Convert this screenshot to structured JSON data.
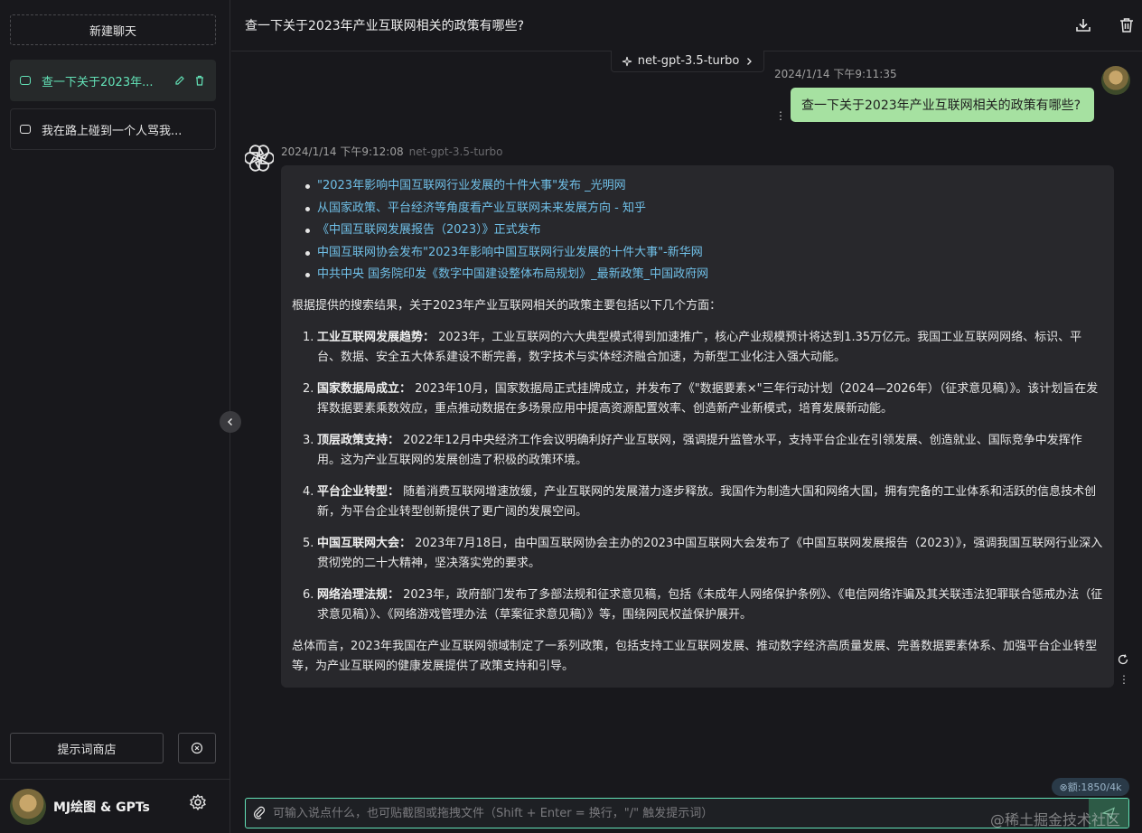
{
  "sidebar": {
    "new_chat": "新建聊天",
    "sessions": [
      {
        "title": "查一下关于2023年..."
      },
      {
        "title": "我在路上碰到一个人骂我..."
      }
    ],
    "prompt_store": "提示词商店",
    "user_name": "MJ绘图 & GPTs"
  },
  "header": {
    "title": "查一下关于2023年产业互联网相关的政策有哪些?"
  },
  "model_chip": "net-gpt-3.5-turbo",
  "user_message": {
    "time": "2024/1/14 下午9:11:35",
    "text": "查一下关于2023年产业互联网相关的政策有哪些?"
  },
  "bot_message": {
    "time": "2024/1/14 下午9:12:08",
    "model": "net-gpt-3.5-turbo",
    "links": [
      "\"2023年影响中国互联网行业发展的十件大事\"发布 _光明网",
      "从国家政策、平台经济等角度看产业互联网未来发展方向 - 知乎",
      "《中国互联网发展报告（2023）》正式发布",
      "中国互联网协会发布\"2023年影响中国互联网行业发展的十件大事\"-新华网",
      "中共中央 国务院印发《数字中国建设整体布局规划》_最新政策_中国政府网"
    ],
    "intro": "根据提供的搜索结果，关于2023年产业互联网相关的政策主要包括以下几个方面：",
    "points": [
      {
        "num": "1.",
        "title": "工业互联网发展趋势：",
        "text": " 2023年，工业互联网的六大典型模式得到加速推广，核心产业规模预计将达到1.35万亿元。我国工业互联网网络、标识、平台、数据、安全五大体系建设不断完善，数字技术与实体经济融合加速，为新型工业化注入强大动能。"
      },
      {
        "num": "2.",
        "title": "国家数据局成立：",
        "text": " 2023年10月，国家数据局正式挂牌成立，并发布了《\"数据要素×\"三年行动计划（2024—2026年）（征求意见稿）》。该计划旨在发挥数据要素乘数效应，重点推动数据在多场景应用中提高资源配置效率、创造新产业新模式，培育发展新动能。"
      },
      {
        "num": "3.",
        "title": "顶层政策支持：",
        "text": " 2022年12月中央经济工作会议明确利好产业互联网，强调提升监管水平，支持平台企业在引领发展、创造就业、国际竞争中发挥作用。这为产业互联网的发展创造了积极的政策环境。"
      },
      {
        "num": "4.",
        "title": "平台企业转型：",
        "text": " 随着消费互联网增速放缓，产业互联网的发展潜力逐步释放。我国作为制造大国和网络大国，拥有完备的工业体系和活跃的信息技术创新，为平台企业转型创新提供了更广阔的发展空间。"
      },
      {
        "num": "5.",
        "title": "中国互联网大会：",
        "text": " 2023年7月18日，由中国互联网协会主办的2023中国互联网大会发布了《中国互联网发展报告（2023）》，强调我国互联网行业深入贯彻党的二十大精神，坚决落实党的要求。"
      },
      {
        "num": "6.",
        "title": "网络治理法规：",
        "text": " 2023年，政府部门发布了多部法规和征求意见稿，包括《未成年人网络保护条例》、《电信网络诈骗及其关联违法犯罪联合惩戒办法（征求意见稿）》、《网络游戏管理办法（草案征求意见稿）》等，围绕网民权益保护展开。"
      }
    ],
    "summary": "总体而言，2023年我国在产业互联网领域制定了一系列政策，包括支持工业互联网发展、推动数字经济高质量发展、完善数据要素体系、加强平台企业转型等，为产业互联网的健康发展提供了政策支持和引导。"
  },
  "composer": {
    "token_badge": "⊗额:1850/4k",
    "placeholder": "可输入说点什么，也可贴截图或拖拽文件（Shift + Enter = 换行，\"/\" 触发提示词）"
  },
  "watermark": "@稀土掘金技术社区",
  "colors": {
    "accent": "#63e2b7",
    "user_bubble": "#a6e1a1",
    "link": "#70c0e8"
  }
}
